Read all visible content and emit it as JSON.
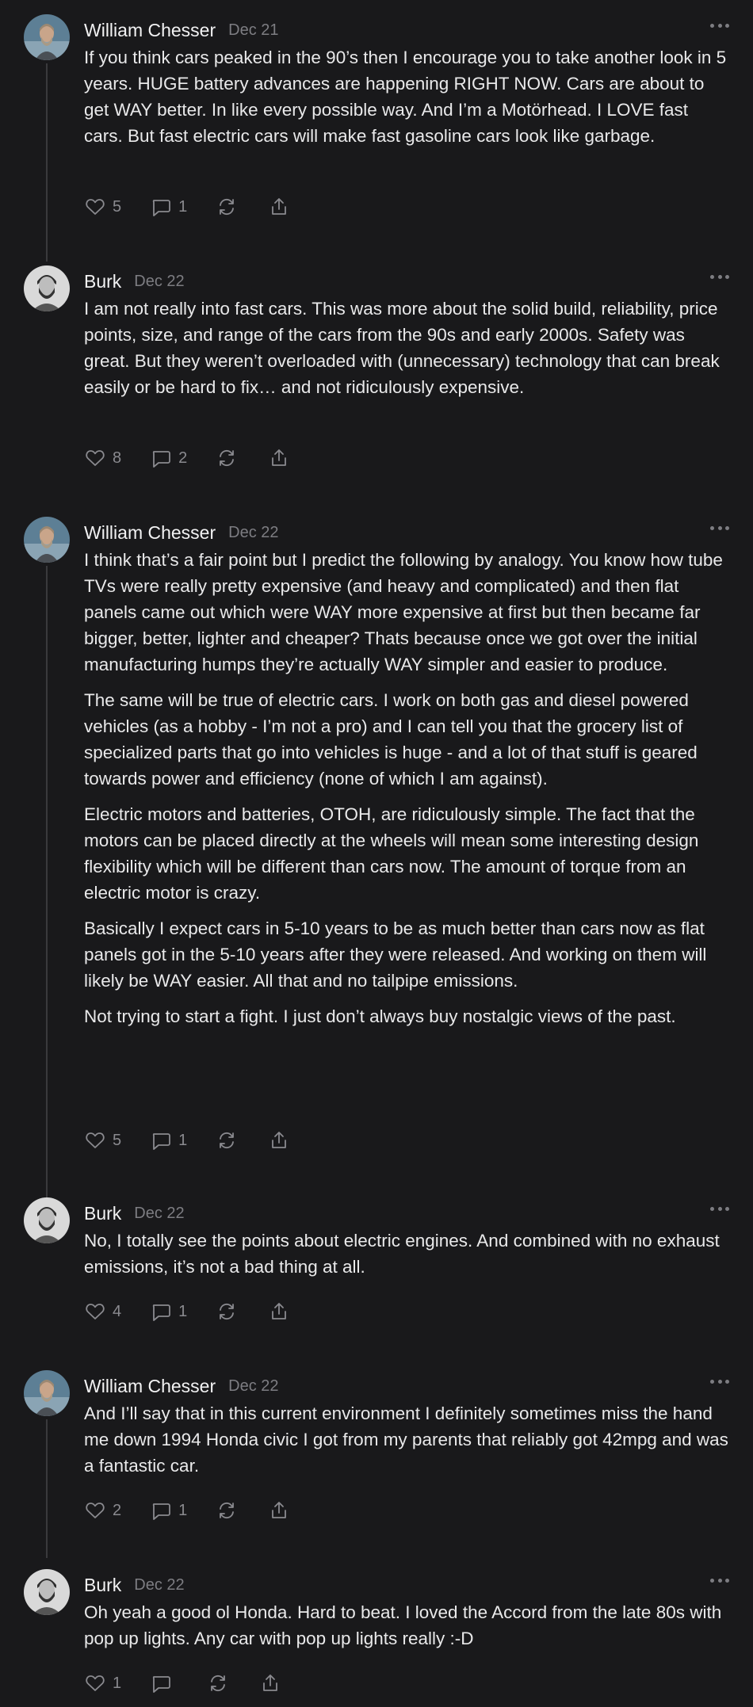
{
  "comments": [
    {
      "author": "William Chesser",
      "date": "Dec 21",
      "paragraphs": [
        "If you think cars peaked in the 90’s then I encourage you to take another look in 5 years. HUGE battery advances are happening RIGHT NOW. Cars are about to get WAY better. In like every possible way. And I’m a Motörhead. I LOVE fast cars. But fast electric cars will make fast gasoline cars look like garbage."
      ],
      "likes": "5",
      "replies": "1",
      "avatar_icon": "avatar-william"
    },
    {
      "author": "Burk",
      "date": "Dec 22",
      "paragraphs": [
        "I am not really into fast cars. This was more about the solid build, reliability, price points, size, and range of the cars from the 90s and early 2000s. Safety was great. But they weren’t overloaded with (unnecessary) technology that can break easily or be hard to fix… and not ridiculously expensive."
      ],
      "likes": "8",
      "replies": "2",
      "avatar_icon": "avatar-burk"
    },
    {
      "author": "William Chesser",
      "date": "Dec 22",
      "paragraphs": [
        "I think that’s a fair point but I predict the following by analogy. You know how tube TVs were really pretty expensive (and heavy and complicated) and then flat panels came out which were WAY more expensive at first but then became far bigger, better, lighter and cheaper? Thats because once we got over the initial manufacturing humps they’re actually WAY simpler and easier to produce.",
        "The same will be true of electric cars. I work on both gas and diesel powered vehicles (as a hobby - I’m not a pro) and I can tell you that the grocery list of specialized parts that go into vehicles is huge - and a lot of that stuff is geared towards power and efficiency (none of which I am against).",
        "Electric motors and batteries, OTOH, are ridiculously simple. The fact that the motors can be placed directly at the wheels will mean some interesting design flexibility which will be different than cars now. The amount of torque from an electric motor is crazy.",
        "Basically I expect cars in 5-10 years to be as much better than cars now as flat panels got in the 5-10 years after they were released. And working on them will likely be WAY easier. All that and no tailpipe emissions.",
        "Not trying to start a fight. I just don’t always buy nostalgic views of the past."
      ],
      "likes": "5",
      "replies": "1",
      "avatar_icon": "avatar-william"
    },
    {
      "author": "Burk",
      "date": "Dec 22",
      "paragraphs": [
        "No, I totally see the points about electric engines. And combined with no exhaust emissions, it’s not a bad thing at all."
      ],
      "likes": "4",
      "replies": "1",
      "avatar_icon": "avatar-burk"
    },
    {
      "author": "William Chesser",
      "date": "Dec 22",
      "paragraphs": [
        "And I’ll say that in this current environment I definitely sometimes miss the hand me down 1994 Honda civic I got from my parents that reliably got 42mpg and was a fantastic car."
      ],
      "likes": "2",
      "replies": "1",
      "avatar_icon": "avatar-william"
    },
    {
      "author": "Burk",
      "date": "Dec 22",
      "paragraphs": [
        "Oh yeah a good ol Honda. Hard to beat. I loved the Accord from the late 80s with pop up lights. Any car with pop up lights really :-D"
      ],
      "likes": "1",
      "replies": "",
      "avatar_icon": "avatar-burk"
    }
  ],
  "colors": {
    "background": "#19191b",
    "text": "#e9e9ea",
    "muted": "#7d7d82",
    "thread_line": "#3a3a3d"
  }
}
